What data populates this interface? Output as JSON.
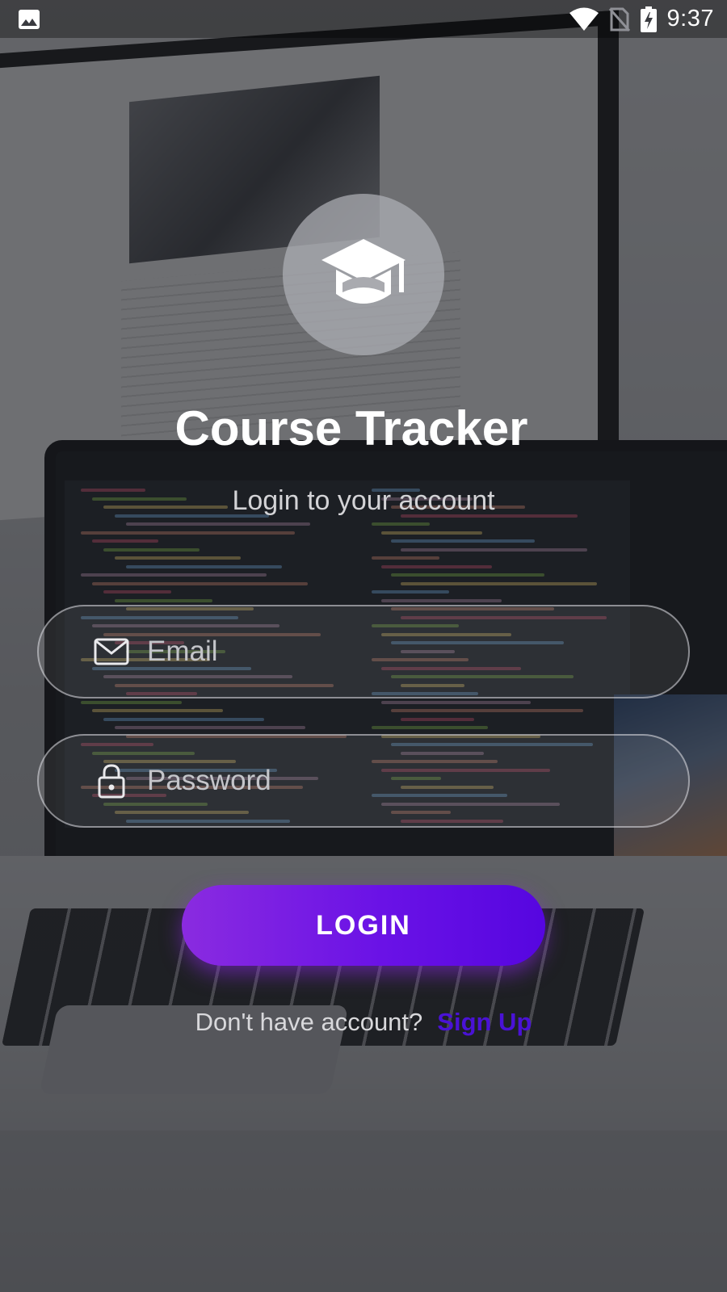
{
  "status_bar": {
    "time": "9:37",
    "icons": [
      "image-notification-icon",
      "wifi-icon",
      "no-sim-icon",
      "battery-charging-icon"
    ]
  },
  "app": {
    "logo_icon": "graduation-cap-icon",
    "title": "Course Tracker",
    "subtitle": "Login to your account"
  },
  "form": {
    "email": {
      "icon": "mail-icon",
      "placeholder": "Email",
      "value": ""
    },
    "password": {
      "icon": "lock-icon",
      "placeholder": "Password",
      "value": ""
    },
    "login_label": "LOGIN"
  },
  "signup": {
    "prompt": "Don't have account?",
    "link_label": "Sign Up"
  },
  "colors": {
    "accent_start": "#8a2be0",
    "accent_end": "#5606e0",
    "link": "#4a12d6",
    "text_primary": "#ffffff"
  }
}
